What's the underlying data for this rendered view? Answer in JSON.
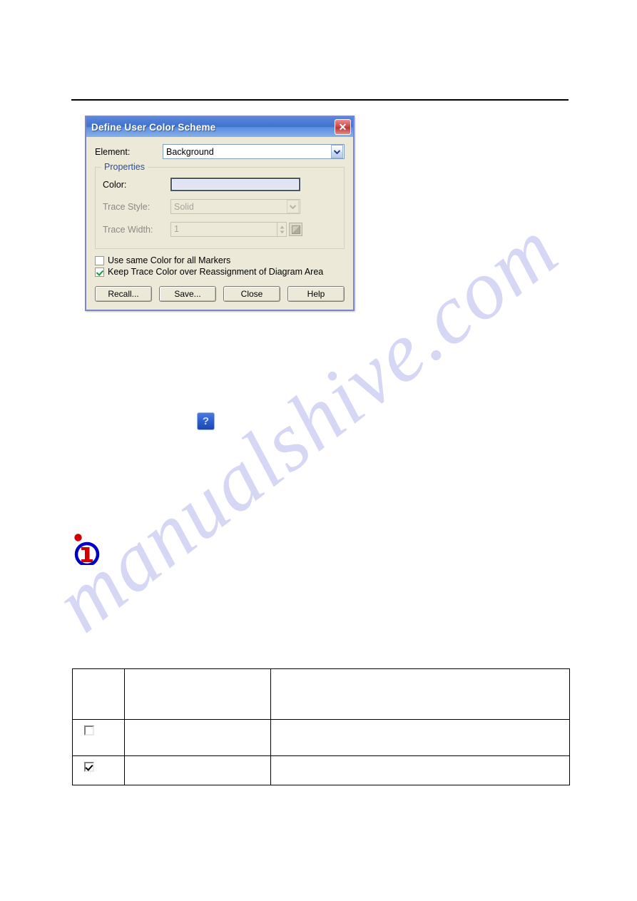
{
  "page": {
    "watermark_text": "manualshive.com",
    "rule_visible": true
  },
  "dialog": {
    "title": "Define User Color Scheme",
    "close_label": "✕",
    "element_row": {
      "label": "Element:",
      "value": "Background",
      "arrow_icon": "chevron-down-icon"
    },
    "properties": {
      "group_title": "Properties",
      "color": {
        "label": "Color:",
        "swatch_color": "#e2e4f6"
      },
      "trace_style": {
        "label": "Trace Style:",
        "value": "Solid",
        "disabled": true
      },
      "trace_width": {
        "label": "Trace Width:",
        "value": "1",
        "disabled": true
      }
    },
    "checkboxes": [
      {
        "label": "Use same Color for all Markers",
        "checked": false
      },
      {
        "label": "Keep Trace Color over Reassignment of Diagram Area",
        "checked": true
      }
    ],
    "buttons": [
      {
        "label": "Recall..."
      },
      {
        "label": "Save..."
      },
      {
        "label": "Close"
      },
      {
        "label": "Help"
      }
    ]
  },
  "help_icon": {
    "glyph": "?",
    "name": "help-question-icon"
  },
  "info_icon": {
    "name": "information-icon",
    "ring_color": "#0000c8",
    "mark_color": "#d00000"
  },
  "legend_table": {
    "rows": [
      {
        "symbol": "",
        "col2": "",
        "col3": ""
      },
      {
        "symbol": "unchecked-checkbox-icon",
        "col2": "",
        "col3": ""
      },
      {
        "symbol": "checked-checkbox-icon",
        "col2": "",
        "col3": ""
      }
    ]
  }
}
